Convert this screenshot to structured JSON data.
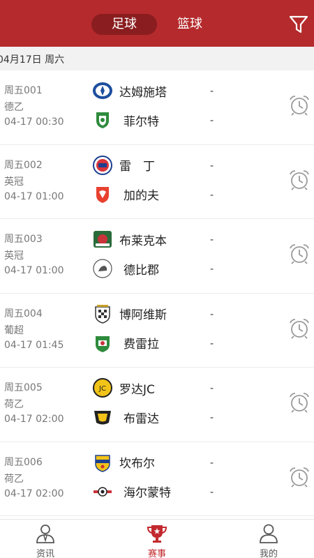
{
  "header": {
    "tabs": [
      {
        "label": "足球",
        "active": true
      },
      {
        "label": "篮球",
        "active": false
      }
    ],
    "filter_icon": "filter-icon",
    "bg_color": "#b52a2c"
  },
  "date_bar": {
    "text": "04月17日 周六"
  },
  "matches": [
    {
      "num": "周五001",
      "league": "德乙",
      "time": "04-17 00:30",
      "home": "达姆施塔",
      "away": "菲尔特",
      "home_score": "-",
      "away_score": "-"
    },
    {
      "num": "周五002",
      "league": "英冠",
      "time": "04-17 01:00",
      "home": "雷　丁",
      "away": "加的夫",
      "home_score": "-",
      "away_score": "-"
    },
    {
      "num": "周五003",
      "league": "英冠",
      "time": "04-17 01:00",
      "home": "布莱克本",
      "away": "德比郡",
      "home_score": "-",
      "away_score": "-"
    },
    {
      "num": "周五004",
      "league": "葡超",
      "time": "04-17 01:45",
      "home": "博阿维斯",
      "away": "费雷拉",
      "home_score": "-",
      "away_score": "-"
    },
    {
      "num": "周五005",
      "league": "荷乙",
      "time": "04-17 02:00",
      "home": "罗达JC",
      "away": "布雷达",
      "home_score": "-",
      "away_score": "-"
    },
    {
      "num": "周五006",
      "league": "荷乙",
      "time": "04-17 02:00",
      "home": "坎布尔",
      "away": "海尔蒙特",
      "home_score": "-",
      "away_score": "-"
    }
  ],
  "tabbar": [
    {
      "label": "资讯",
      "icon": "news-person-icon",
      "active": false
    },
    {
      "label": "赛事",
      "icon": "trophy-icon",
      "active": true
    },
    {
      "label": "我的",
      "icon": "user-icon",
      "active": false
    }
  ],
  "colors": {
    "accent": "#c2292e",
    "segment_active": "#8a1d1f"
  }
}
